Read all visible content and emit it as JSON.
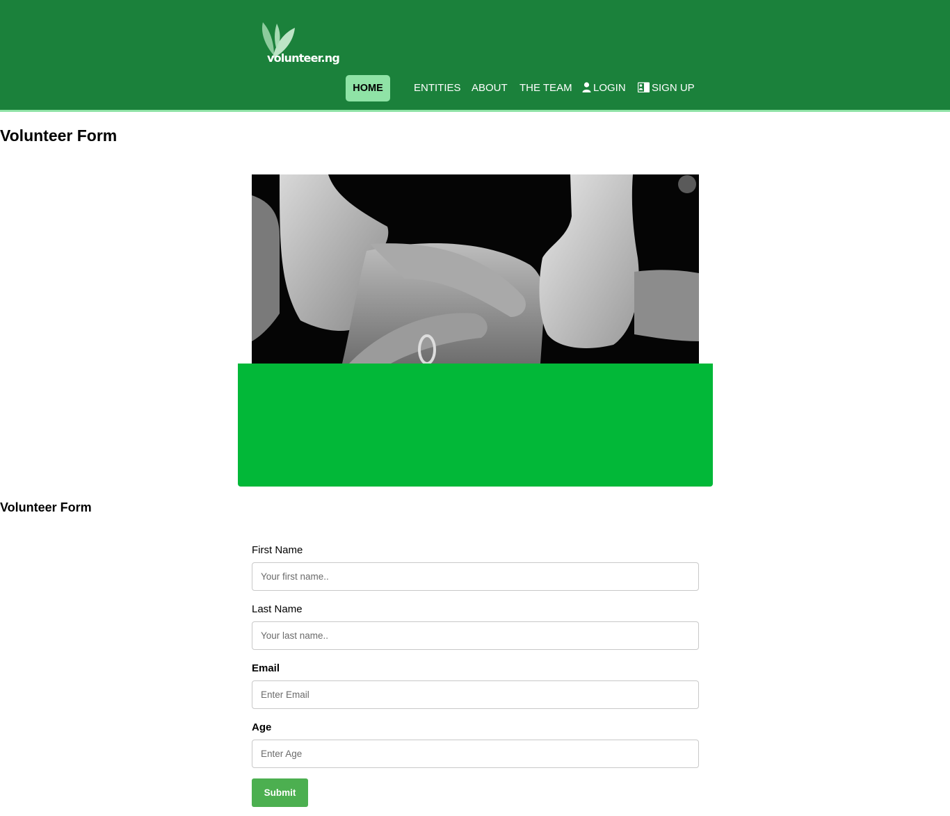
{
  "header": {
    "logo_text": "volunteer.ng",
    "nav": {
      "home": "HOME",
      "entities": "ENTITIES",
      "about": "ABOUT",
      "team": "THE TEAM",
      "login": "LOGIN",
      "signup": "SIGN UP"
    },
    "colors": {
      "header_bg": "#1b813b",
      "active_nav_bg": "#8fe3a6"
    }
  },
  "main": {
    "page_title": "Volunteer Form",
    "section_title": "Volunteer Form",
    "hero_image": "black-and-white photo of hands holding each other's wrists",
    "banner_color": "#02b838"
  },
  "form": {
    "first_name": {
      "label": "First Name",
      "placeholder": "Your first name.."
    },
    "last_name": {
      "label": "Last Name",
      "placeholder": "Your last name.."
    },
    "email": {
      "label": "Email",
      "placeholder": "Enter Email"
    },
    "age": {
      "label": "Age",
      "placeholder": "Enter Age"
    },
    "submit_label": "Submit",
    "submit_color": "#4caf50"
  }
}
